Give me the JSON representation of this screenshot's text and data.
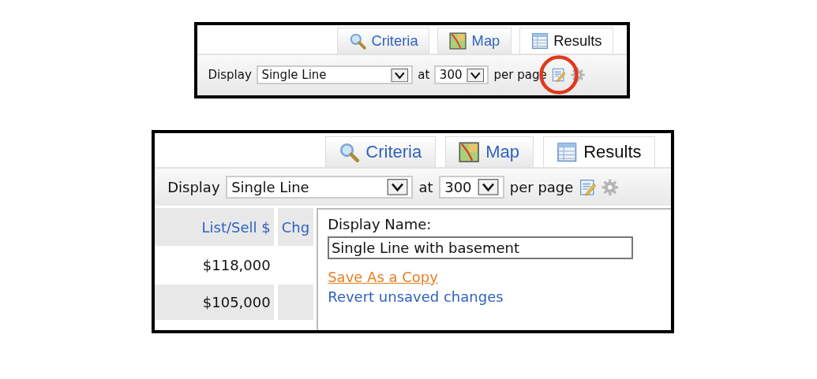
{
  "panels": [
    {
      "tabs": [
        {
          "label": "Criteria",
          "kind": "search",
          "selected": false
        },
        {
          "label": "Map",
          "kind": "map",
          "selected": false
        },
        {
          "label": "Results",
          "kind": "table",
          "selected": true
        }
      ],
      "toolbar": {
        "display_label": "Display",
        "display_value": "Single Line",
        "at_label": "at",
        "per_page_value": "300",
        "per_page_label": "per page"
      },
      "edit_icon_circled": true
    },
    {
      "tabs": [
        {
          "label": "Criteria",
          "kind": "search",
          "selected": false
        },
        {
          "label": "Map",
          "kind": "map",
          "selected": false
        },
        {
          "label": "Results",
          "kind": "table",
          "selected": true
        }
      ],
      "toolbar": {
        "display_label": "Display",
        "display_value": "Single Line",
        "at_label": "at",
        "per_page_value": "300",
        "per_page_label": "per page"
      },
      "edit_icon_circled": false,
      "table": {
        "columns": [
          "List/Sell $",
          "Chg"
        ],
        "rows": [
          {
            "price": "$118,000"
          },
          {
            "price": "$105,000"
          }
        ]
      },
      "popup": {
        "label": "Display Name:",
        "value": "Single Line with basement",
        "links": [
          {
            "text": "Save As a Copy",
            "kind": "hover"
          },
          {
            "text": "Revert unsaved changes",
            "kind": "normal"
          }
        ]
      }
    }
  ]
}
